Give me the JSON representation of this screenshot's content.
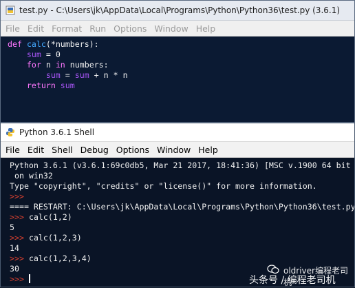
{
  "editor": {
    "title": "test.py - C:\\Users\\jk\\AppData\\Local\\Programs\\Python\\Python36\\test.py (3.6.1)",
    "menu": [
      "File",
      "Edit",
      "Format",
      "Run",
      "Options",
      "Window",
      "Help"
    ],
    "code": {
      "l1_kw": "def",
      "l1_fn": "calc",
      "l1_rest": "(*numbers):",
      "l2_var": "sum",
      "l2_rest": " = 0",
      "l3_kw1": "for",
      "l3_mid": " n ",
      "l3_kw2": "in",
      "l3_rest": " numbers:",
      "l4_var1": "sum",
      "l4_eq": " = ",
      "l4_var2": "sum",
      "l4_rest": " + n * n",
      "l5_kw": "return",
      "l5_var": "sum"
    }
  },
  "shell": {
    "title": "Python 3.6.1 Shell",
    "menu": [
      "File",
      "Edit",
      "Shell",
      "Debug",
      "Options",
      "Window",
      "Help"
    ],
    "banner1": "Python 3.6.1 (v3.6.1:69c0db5, Mar 21 2017, 18:41:36) [MSC v.1900 64 bit",
    "banner2": " on win32",
    "banner3": "Type \"copyright\", \"credits\" or \"license()\" for more information.",
    "prompt": ">>>",
    "restart": "==== RESTART: C:\\Users\\jk\\AppData\\Local\\Programs\\Python\\Python36\\test.py",
    "call1": "calc(1,2)",
    "out1": "5",
    "call2": "calc(1,2,3)",
    "out2": "14",
    "call3": "calc(1,2,3,4)",
    "out3": "30"
  },
  "watermark": {
    "line1": "oldriver编程老司机",
    "line2": "头条号 / 编程老司机"
  },
  "colors": {
    "keyword": "#ff77ff",
    "builtin": "#a855f7",
    "function": "#44aaff",
    "prompt": "#d9402f",
    "background": "#0b1a33"
  }
}
